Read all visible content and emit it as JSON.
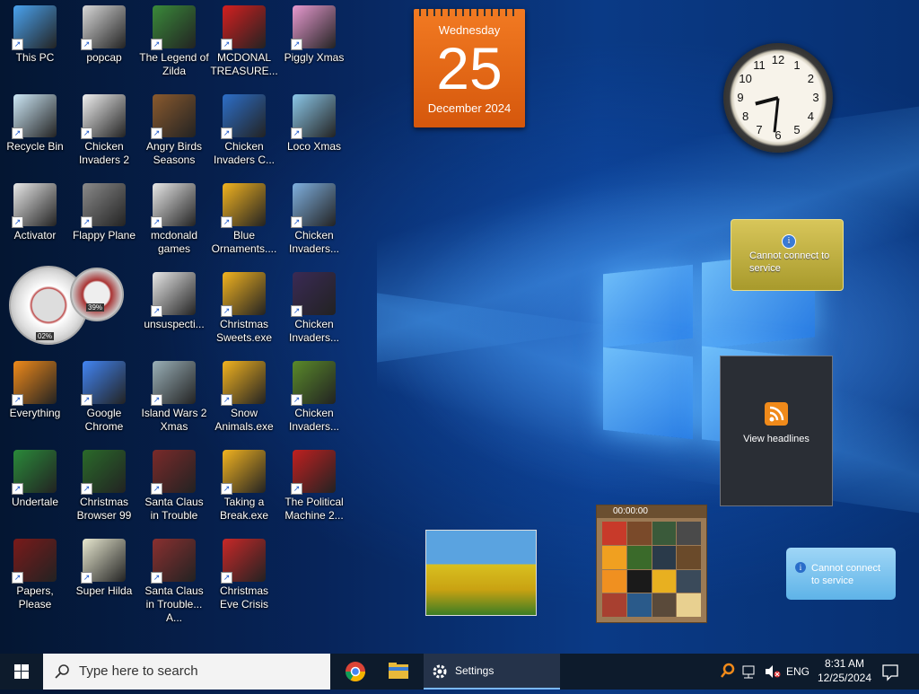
{
  "desktop_icons": [
    {
      "label": "This PC",
      "color": "#4aa3f0"
    },
    {
      "label": "popcap",
      "color": "#d8d8d8"
    },
    {
      "label": "The Legend of Zilda",
      "color": "#3a8a3a"
    },
    {
      "label": "MCDONAL TREASURE...",
      "color": "#d41f1f"
    },
    {
      "label": "Piggly Xmas",
      "color": "#e89ad0"
    },
    {
      "label": "Recycle Bin",
      "color": "#cde8f7"
    },
    {
      "label": "Chicken Invaders 2",
      "color": "#f0f0f0"
    },
    {
      "label": "Angry Birds Seasons",
      "color": "#8a5a2e"
    },
    {
      "label": "Chicken Invaders C...",
      "color": "#2d6fc9"
    },
    {
      "label": "Loco Xmas",
      "color": "#8bc7e8"
    },
    {
      "label": "Activator",
      "color": "#e8e8e8"
    },
    {
      "label": "Flappy Plane",
      "color": "#8a8a8a"
    },
    {
      "label": "mcdonald games",
      "color": "#e8e8e8"
    },
    {
      "label": "Blue Ornaments....",
      "color": "#f2b320"
    },
    {
      "label": "Chicken Invaders...",
      "color": "#7fb0e0"
    },
    {
      "label": "unsuspecti...",
      "color": "#e8e8e8"
    },
    {
      "label": "Christmas Sweets.exe",
      "color": "#f2b320"
    },
    {
      "label": "Chicken Invaders...",
      "color": "#3a2a55"
    },
    {
      "label": "Everything",
      "color": "#f08a1a"
    },
    {
      "label": "Google Chrome",
      "color": "#4285f4"
    },
    {
      "label": "Island Wars 2 Xmas",
      "color": "#9ab0b8"
    },
    {
      "label": "Snow Animals.exe",
      "color": "#f2b320"
    },
    {
      "label": "Chicken Invaders...",
      "color": "#5a8a2a"
    },
    {
      "label": "Undertale",
      "color": "#2a8a3a"
    },
    {
      "label": "Christmas Browser 99",
      "color": "#2a6a2a"
    },
    {
      "label": "Santa Claus in Trouble",
      "color": "#7a2a2a"
    },
    {
      "label": "Taking a Break.exe",
      "color": "#f2b320"
    },
    {
      "label": "The Political Machine 2...",
      "color": "#c02020"
    },
    {
      "label": "Papers, Please",
      "color": "#7a1a1a"
    },
    {
      "label": "Super Hilda",
      "color": "#e8e8d0"
    },
    {
      "label": "Santa Claus in Trouble... A...",
      "color": "#8a3030"
    },
    {
      "label": "Christmas Eve Crisis",
      "color": "#c82828"
    }
  ],
  "gauge": {
    "cpu_pct": "02%",
    "mem_pct": "39%"
  },
  "calendar": {
    "weekday": "Wednesday",
    "day": "25",
    "month_year": "December 2024"
  },
  "clock": {
    "numbers": [
      "12",
      "1",
      "2",
      "3",
      "4",
      "5",
      "6",
      "7",
      "8",
      "9",
      "10",
      "11"
    ],
    "hour": 8,
    "minute": 31
  },
  "weather_gadget": {
    "message": "Cannot connect to service"
  },
  "rss_gadget": {
    "label": "View headlines"
  },
  "network_gadget": {
    "message": "Cannot connect to service"
  },
  "puzzle_gadget": {
    "timer": "00:00:00"
  },
  "taskbar": {
    "search_placeholder": "Type here to search",
    "settings_label": "Settings",
    "language": "ENG",
    "time": "8:31 AM",
    "date": "12/25/2024"
  }
}
